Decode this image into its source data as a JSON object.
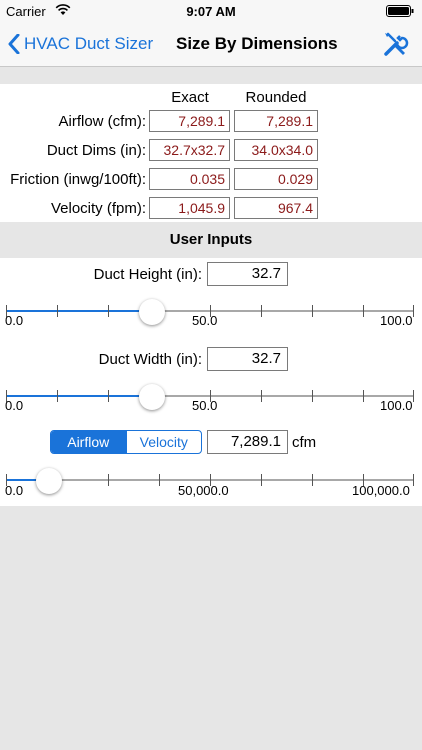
{
  "status": {
    "carrier": "Carrier",
    "time": "9:07 AM"
  },
  "nav": {
    "back_label": "HVAC Duct Sizer",
    "title": "Size By Dimensions"
  },
  "results": {
    "col_exact": "Exact",
    "col_rounded": "Rounded",
    "rows": [
      {
        "label": "Airflow (cfm):",
        "exact": "7,289.1",
        "rounded": "7,289.1"
      },
      {
        "label": "Duct Dims (in):",
        "exact": "32.7x32.7",
        "rounded": "34.0x34.0"
      },
      {
        "label": "Friction (inwg/100ft):",
        "exact": "0.035",
        "rounded": "0.029"
      },
      {
        "label": "Velocity (fpm):",
        "exact": "1,045.9",
        "rounded": "967.4"
      }
    ]
  },
  "inputs": {
    "section_title": "User Inputs",
    "height": {
      "label": "Duct Height (in):",
      "value": "32.7",
      "min_label": "0.0",
      "mid_label": "50.0",
      "max_label": "100.0",
      "level": 0.327
    },
    "width": {
      "label": "Duct Width (in):",
      "value": "32.7",
      "min_label": "0.0",
      "mid_label": "50.0",
      "max_label": "100.0",
      "level": 0.327
    },
    "flow": {
      "seg_airflow": "Airflow",
      "seg_velocity": "Velocity",
      "value": "7,289.1",
      "unit": "cfm",
      "min_label": "0.0",
      "mid_label": "50,000.0",
      "max_label": "100,000.0",
      "level": 0.073
    }
  },
  "colors": {
    "accent": "#1a73d9",
    "value_text": "#8b1a1a",
    "background": "#e6e6e6"
  }
}
